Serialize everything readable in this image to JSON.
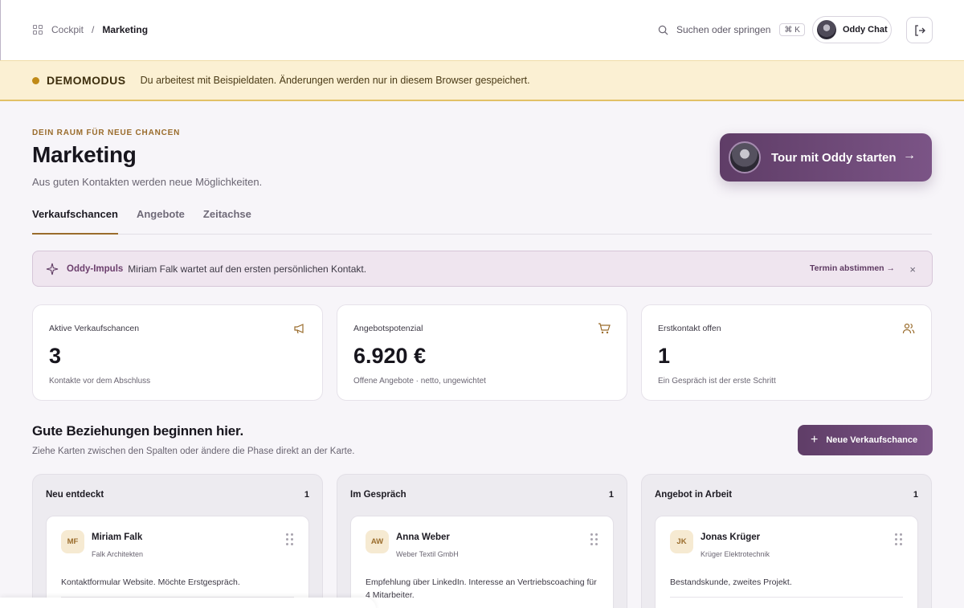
{
  "breadcrumb": {
    "root": "Cockpit",
    "separator": "/",
    "current": "Marketing"
  },
  "search": {
    "label": "Suchen oder springen",
    "shortcut": "⌘ K"
  },
  "chat": {
    "label": "Oddy Chat"
  },
  "banner": {
    "title": "DEMOMODUS",
    "text": "Du arbeitest mit Beispieldaten. Änderungen werden nur in diesem Browser gespeichert."
  },
  "header": {
    "eyebrow": "DEIN RAUM FÜR NEUE CHANCEN",
    "title": "Marketing",
    "subtitle": "Aus guten Kontakten werden neue Möglichkeiten.",
    "tour_label": "Tour mit Oddy starten",
    "tour_arrow": "→"
  },
  "tabs": [
    {
      "label": "Verkaufschancen",
      "active": true
    },
    {
      "label": "Angebote",
      "active": false
    },
    {
      "label": "Zeitachse",
      "active": false
    }
  ],
  "impulse": {
    "label": "Oddy-Impuls",
    "text": "Miriam Falk wartet auf den ersten persönlichen Kontakt.",
    "action": "Termin abstimmen  →",
    "close": "×"
  },
  "stats": [
    {
      "label": "Aktive Verkaufschancen",
      "value": "3",
      "note": "Kontakte vor dem Abschluss",
      "icon": "megaphone-icon"
    },
    {
      "label": "Angebotspotenzial",
      "value": "6.920 €",
      "note": "Offene Angebote · netto, ungewichtet",
      "icon": "cart-icon"
    },
    {
      "label": "Erstkontakt offen",
      "value": "1",
      "note": "Ein Gespräch ist der erste Schritt",
      "icon": "users-icon"
    }
  ],
  "section": {
    "title": "Gute Beziehungen beginnen hier.",
    "subtitle": "Ziehe Karten zwischen den Spalten oder ändere die Phase direkt an der Karte.",
    "new_button": "Neue Verkaufschance",
    "new_button_icon": "+"
  },
  "columns": [
    {
      "title": "Neu entdeckt",
      "count": "1",
      "card": {
        "initials": "MF",
        "name": "Miriam Falk",
        "company": "Falk Architekten",
        "note": "Kontaktformular Website. Möchte Erstgespräch."
      }
    },
    {
      "title": "Im Gespräch",
      "count": "1",
      "card": {
        "initials": "AW",
        "name": "Anna Weber",
        "company": "Weber Textil GmbH",
        "note": "Empfehlung über LinkedIn. Interesse an Vertriebscoaching für 4 Mitarbeiter."
      }
    },
    {
      "title": "Angebot in Arbeit",
      "count": "1",
      "card": {
        "initials": "JK",
        "name": "Jonas Krüger",
        "company": "Krüger Elektrotechnik",
        "note": "Bestandskunde, zweites Projekt."
      }
    }
  ],
  "colors": {
    "accent": "#6a4673",
    "gold": "#9a6c2c",
    "banner_bg": "#fbf0d3"
  }
}
